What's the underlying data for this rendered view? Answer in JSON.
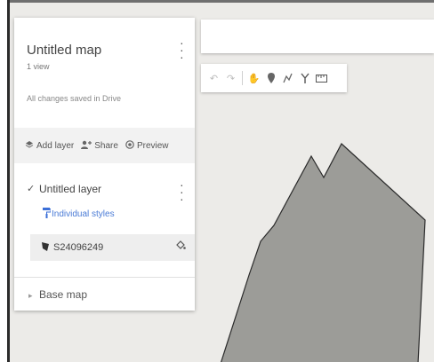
{
  "map_panel": {
    "title": "Untitled map",
    "views": "1 view",
    "save_status": "All changes saved in Drive"
  },
  "actions": {
    "add_layer": "Add layer",
    "share": "Share",
    "preview": "Preview"
  },
  "layer": {
    "name": "Untitled layer",
    "checked": true,
    "style_link": "Individual styles",
    "feature_name": "S24096249"
  },
  "base_map": {
    "label": "Base map"
  },
  "search": {
    "value": ""
  },
  "toolbar": {
    "tools": [
      "undo-icon",
      "redo-icon",
      "hand-icon",
      "marker-icon",
      "draw-line-icon",
      "route-icon",
      "ruler-icon"
    ]
  },
  "map": {
    "background_color": "#ecebe8",
    "polygon_color": "#9c9c98",
    "polygon_outline": "#2a2a2a",
    "accent_link_color": "#4a7bd6"
  }
}
